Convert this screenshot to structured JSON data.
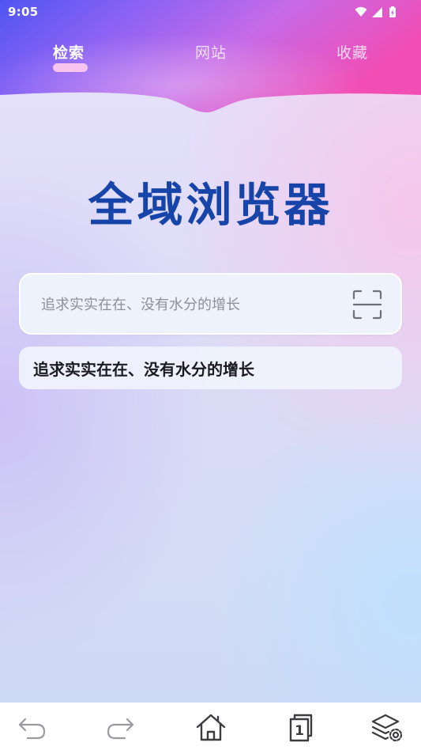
{
  "status_bar": {
    "time": "9:05",
    "icons": [
      "wifi-icon",
      "signal-icon",
      "battery-icon"
    ]
  },
  "tabs": [
    {
      "label": "检索",
      "active": true
    },
    {
      "label": "网站",
      "active": false
    },
    {
      "label": "收藏",
      "active": false
    }
  ],
  "main": {
    "title": "全域浏览器",
    "search": {
      "placeholder": "追求实实在在、没有水分的增长",
      "value": "",
      "scan_icon": "scan-icon"
    },
    "suggestion": "追求实实在在、没有水分的增长"
  },
  "toolbar": {
    "items": [
      "back-icon",
      "forward-icon",
      "home-icon",
      "tabs-icon",
      "layers-settings-icon"
    ],
    "tab_count": "1"
  },
  "colors": {
    "title": "#1744a8",
    "tab_indicator": "#f7c4ef",
    "header_left": "#5a49f2",
    "header_right": "#f04fb8"
  }
}
